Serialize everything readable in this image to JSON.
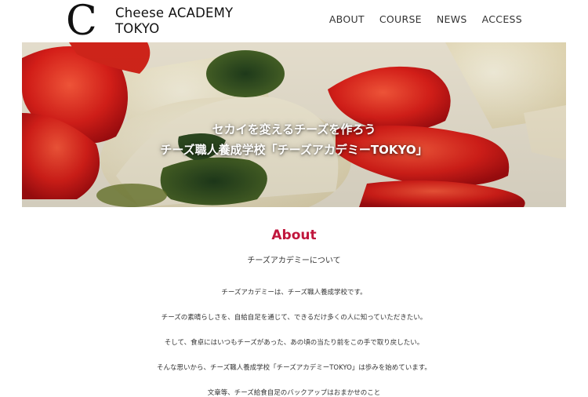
{
  "brand": {
    "mark": "C",
    "line1": "Cheese ACADEMY",
    "line2": "TOKYO"
  },
  "nav": {
    "items": [
      "ABOUT",
      "COURSE",
      "NEWS",
      "ACCESS"
    ]
  },
  "hero": {
    "line1": "セカイを変えるチーズを作ろう",
    "line2": "チーズ職人養成学校「チーズアカデミーTOKYO」"
  },
  "about": {
    "title": "About",
    "subtitle": "チーズアカデミーについて",
    "paragraphs": [
      "チーズアカデミーは、チーズ職人養成学校です。",
      "チーズの素晴らしさを、自給自足を通じて、できるだけ多くの人に知っていただきたい。",
      "そして、食卓にはいつもチーズがあった、あの頃の当たり前をこの手で取り戻したい。",
      "そんな思いから、チーズ職人養成学校「チーズアカデミーTOKYO」は歩みを始めています。",
      "文章等、チーズ給食自足のバックアップはおまかせのこと"
    ]
  },
  "colors": {
    "accent": "#c0163c",
    "text": "#333333"
  }
}
